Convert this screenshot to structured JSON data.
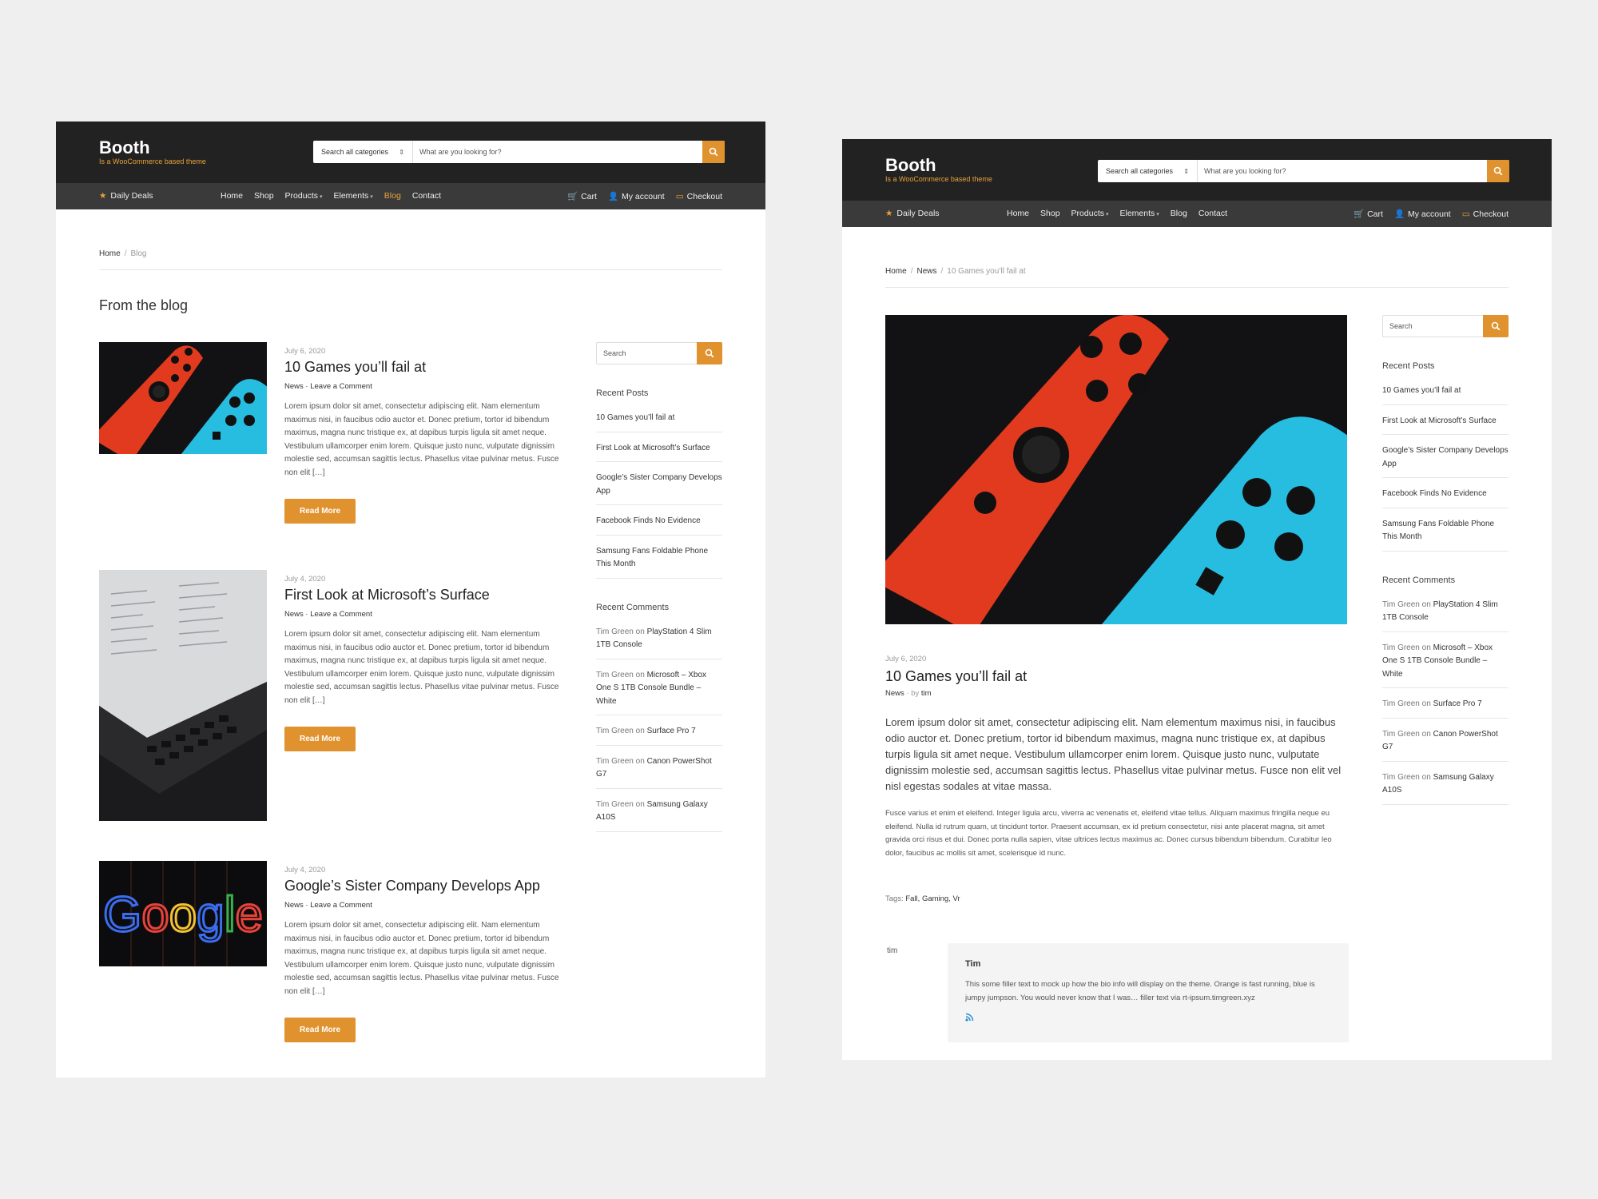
{
  "site": {
    "title": "Booth",
    "tagline": "Is a WooCommerce based theme",
    "search_category": "Search all categories",
    "search_placeholder": "What are you looking for?"
  },
  "nav": {
    "deals": "Daily Deals",
    "menu": [
      "Home",
      "Shop",
      "Products",
      "Elements",
      "Blog",
      "Contact"
    ],
    "account": [
      "Cart",
      "My account",
      "Checkout"
    ]
  },
  "colors": {
    "accent": "#e0922f",
    "header_bg": "#222222",
    "nav_bg": "#3a3a3a"
  },
  "blog_page": {
    "breadcrumb": [
      "Home",
      "Blog"
    ],
    "heading": "From the blog",
    "read_more": "Read More",
    "posts": [
      {
        "date": "July 6, 2020",
        "title": "10 Games you’ll fail at",
        "category": "News",
        "comment_link": "Leave a Comment",
        "excerpt": "Lorem ipsum dolor sit amet, consectetur adipiscing elit. Nam elementum maximus nisi, in faucibus odio auctor et. Donec pretium, tortor id bibendum maximus, magna nunc tristique ex, at dapibus turpis ligula sit amet neque. Vestibulum ullamcorper enim lorem. Quisque justo nunc, vulputate dignissim molestie sed, accumsan sagittis lectus. Phasellus vitae pulvinar metus. Fusce non elit […]",
        "image": "game-controllers"
      },
      {
        "date": "July 4, 2020",
        "title": "First Look at Microsoft’s Surface",
        "category": "News",
        "comment_link": "Leave a Comment",
        "excerpt": "Lorem ipsum dolor sit amet, consectetur adipiscing elit. Nam elementum maximus nisi, in faucibus odio auctor et. Donec pretium, tortor id bibendum maximus, magna nunc tristique ex, at dapibus turpis ligula sit amet neque. Vestibulum ullamcorper enim lorem. Quisque justo nunc, vulputate dignissim molestie sed, accumsan sagittis lectus. Phasellus vitae pulvinar metus. Fusce non elit […]",
        "image": "surface-tablet"
      },
      {
        "date": "July 4, 2020",
        "title": "Google’s Sister Company Develops App",
        "category": "News",
        "comment_link": "Leave a Comment",
        "excerpt": "Lorem ipsum dolor sit amet, consectetur adipiscing elit. Nam elementum maximus nisi, in faucibus odio auctor et. Donec pretium, tortor id bibendum maximus, magna nunc tristique ex, at dapibus turpis ligula sit amet neque. Vestibulum ullamcorper enim lorem. Quisque justo nunc, vulputate dignissim molestie sed, accumsan sagittis lectus. Phasellus vitae pulvinar metus. Fusce non elit […]",
        "image": "google-logo",
        "image_text": "Google"
      }
    ]
  },
  "sidebar": {
    "search_placeholder": "Search",
    "recent_posts_title": "Recent Posts",
    "recent_posts": [
      "10 Games you’ll fail at",
      "First Look at Microsoft’s Surface",
      "Google’s Sister Company Develops App",
      "Facebook Finds No Evidence",
      "Samsung Fans Foldable Phone This Month"
    ],
    "recent_comments_title": "Recent Comments",
    "recent_comments": [
      {
        "author": "Tim Green",
        "on": "on",
        "post": "PlayStation 4 Slim 1TB Console"
      },
      {
        "author": "Tim Green",
        "on": "on",
        "post": "Microsoft – Xbox One S 1TB Console Bundle – White"
      },
      {
        "author": "Tim Green",
        "on": "on",
        "post": "Surface Pro 7"
      },
      {
        "author": "Tim Green",
        "on": "on",
        "post": "Canon PowerShot G7"
      },
      {
        "author": "Tim Green",
        "on": "on",
        "post": "Samsung Galaxy A10S"
      }
    ]
  },
  "single_page": {
    "breadcrumb": [
      "Home",
      "News",
      "10 Games you’ll fail at"
    ],
    "date": "July 6, 2020",
    "title": "10 Games you’ll fail at",
    "category": "News",
    "by": "by",
    "author": "tim",
    "lead": "Lorem ipsum dolor sit amet, consectetur adipiscing elit. Nam elementum maximus nisi, in faucibus odio auctor et. Donec pretium, tortor id bibendum maximus, magna nunc tristique ex, at dapibus turpis ligula sit amet neque. Vestibulum ullamcorper enim lorem. Quisque justo nunc, vulputate dignissim molestie sed, accumsan sagittis lectus. Phasellus vitae pulvinar metus. Fusce non elit vel nisl egestas sodales at vitae massa.",
    "paragraph": "Fusce varius et enim et eleifend. Integer ligula arcu, viverra ac venenatis et, eleifend vitae tellus. Aliquam maximus fringilla neque eu eleifend. Nulla id rutrum quam, ut tincidunt tortor. Praesent accumsan, ex id pretium consectetur, nisi ante placerat magna, sit amet gravida orci risus et dui. Donec porta nulla sapien, vitae ultrices lectus maximus ac. Donec cursus bibendum bibendum. Curabitur leo dolor, faucibus ac mollis sit amet, scelerisque id nunc.",
    "tags_label": "Tags:",
    "tags": "Fall, Gaming, Vr",
    "author_avatar_alt": "tim",
    "author_box": {
      "name": "Tim",
      "bio": "This some filler text to mock up how the bio info will display on the theme. Orange is fast running, blue is jumpy jumpson. You would never know that I was… filler text via rt-ipsum.timgreen.xyz"
    }
  }
}
